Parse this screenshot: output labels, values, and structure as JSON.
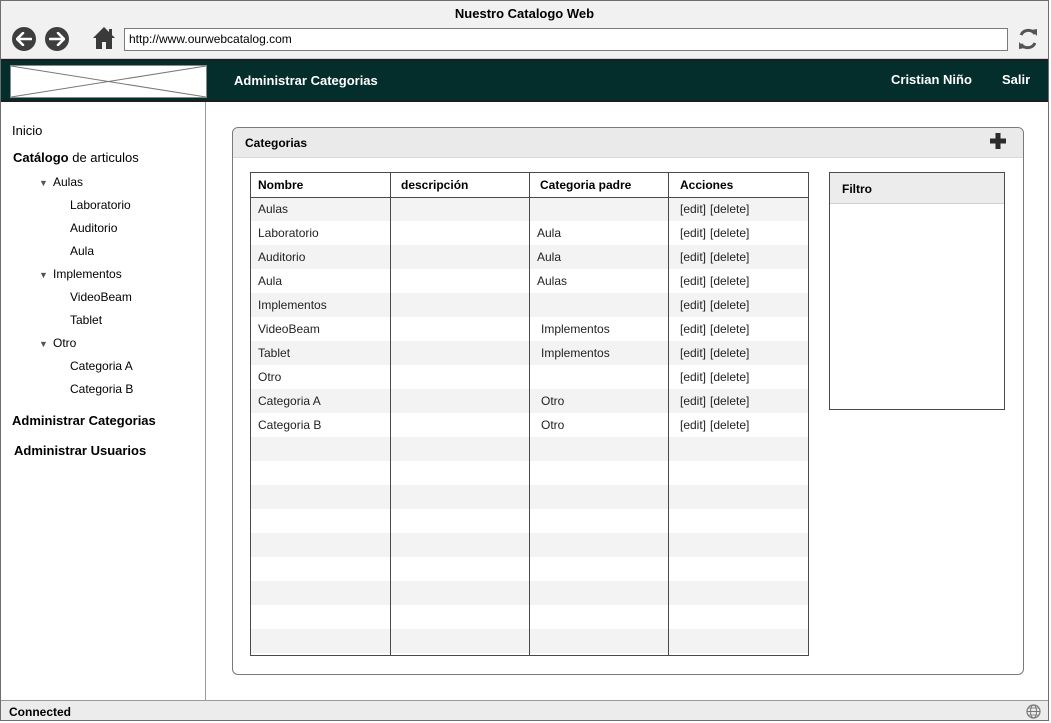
{
  "window": {
    "title": "Nuestro Catalogo Web"
  },
  "toolbar": {
    "url": "http://www.ourwebcatalog.com"
  },
  "header": {
    "title": "Administrar Categorias",
    "user": "Cristian Niño",
    "logout": "Salir"
  },
  "sidebar": {
    "inicio": "Inicio",
    "catalogo_bold": "Catálogo",
    "catalogo_rest": " de articulos",
    "groups": [
      {
        "label": "Aulas",
        "items": [
          "Laboratorio",
          "Auditorio",
          "Aula"
        ]
      },
      {
        "label": "Implementos",
        "items": [
          "VideoBeam",
          "Tablet"
        ]
      },
      {
        "label": "Otro",
        "items": [
          "Categoria A",
          "Categoria B"
        ]
      }
    ],
    "admin_categorias": "Administrar Categorias",
    "admin_usuarios": "Administrar Usuarios"
  },
  "panel": {
    "title": "Categorias"
  },
  "table": {
    "headers": [
      "Nombre",
      "descripción",
      "Categoria padre",
      "Acciones"
    ],
    "rows": [
      {
        "nombre": "Aulas",
        "descripcion": "",
        "padre": "",
        "edit": "[edit]",
        "delete": "[delete]"
      },
      {
        "nombre": "Laboratorio",
        "descripcion": "",
        "padre": "Aula",
        "edit": "[edit]",
        "delete": "[delete]"
      },
      {
        "nombre": "Auditorio",
        "descripcion": "",
        "padre": "Aula",
        "edit": "[edit]",
        "delete": "[delete]"
      },
      {
        "nombre": "Aula",
        "descripcion": "",
        "padre": "Aulas",
        "edit": "[edit]",
        "delete": "[delete]"
      },
      {
        "nombre": "Implementos",
        "descripcion": "",
        "padre": "",
        "edit": "[edit]",
        "delete": "[delete]"
      },
      {
        "nombre": "VideoBeam",
        "descripcion": "",
        "padre": "Implementos",
        "edit": "[edit]",
        "delete": "[delete]"
      },
      {
        "nombre": "Tablet",
        "descripcion": "",
        "padre": "Implementos",
        "edit": "[edit]",
        "delete": "[delete]"
      },
      {
        "nombre": "Otro",
        "descripcion": "",
        "padre": "",
        "edit": "[edit]",
        "delete": "[delete]"
      },
      {
        "nombre": "Categoria A",
        "descripcion": "",
        "padre": "Otro",
        "edit": "[edit]",
        "delete": "[delete]"
      },
      {
        "nombre": "Categoria B",
        "descripcion": "",
        "padre": "Otro",
        "edit": "[edit]",
        "delete": "[delete]"
      }
    ]
  },
  "filter": {
    "title": "Filtro"
  },
  "status": {
    "text": "Connected"
  },
  "icons": {
    "back": "arrow-left-circle-icon",
    "forward": "arrow-right-circle-icon",
    "home": "home-icon",
    "refresh": "refresh-icon",
    "add": "plus-icon",
    "globe": "globe-icon",
    "expand": "triangle-down-icon"
  },
  "colors": {
    "header_bg": "#032e2b",
    "header_text": "#ffffff",
    "row_alt": "#f3f3f3"
  }
}
